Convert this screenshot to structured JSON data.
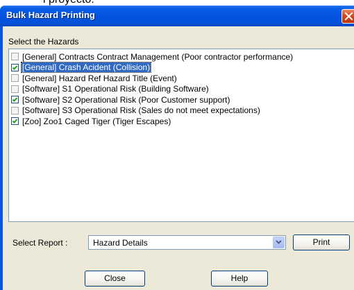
{
  "background": {
    "partial_text": "l proyecto:"
  },
  "window": {
    "title": "Bulk Hazard Printing",
    "close_icon": "close-x-icon",
    "titlebar_color": "#0454e0"
  },
  "hazards": {
    "label": "Select the Hazards",
    "items": [
      {
        "label": "[General] Contracts Contract Management (Poor contractor performance)",
        "checked": false,
        "selected": false
      },
      {
        "label": "[General] Crash Acident (Collision)",
        "checked": true,
        "selected": true
      },
      {
        "label": "[General] Hazard Ref Hazard Title (Event)",
        "checked": false,
        "selected": false
      },
      {
        "label": "[Software] S1 Operational Risk (Building Software)",
        "checked": false,
        "selected": false
      },
      {
        "label": "[Software] S2 Operational Risk (Poor Customer support)",
        "checked": true,
        "selected": false
      },
      {
        "label": "[Software] S3 Operational Risk (Sales do not meet expectations)",
        "checked": false,
        "selected": false
      },
      {
        "label": "[Zoo] Zoo1 Caged Tiger (Tiger Escapes)",
        "checked": true,
        "selected": false
      }
    ]
  },
  "report": {
    "label": "Select Report :",
    "selected": "Hazard Details",
    "dropdown_icon": "chevron-down-icon"
  },
  "buttons": {
    "print": "Print",
    "close": "Close",
    "help": "Help"
  }
}
